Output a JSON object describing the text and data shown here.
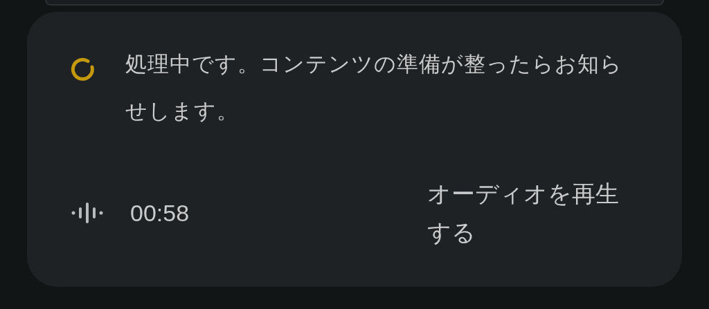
{
  "status": {
    "message": "処理中です。コンテンツの準備が整ったらお知らせします。"
  },
  "audio": {
    "duration": "00:58",
    "play_label": "オーディオを再生する"
  }
}
